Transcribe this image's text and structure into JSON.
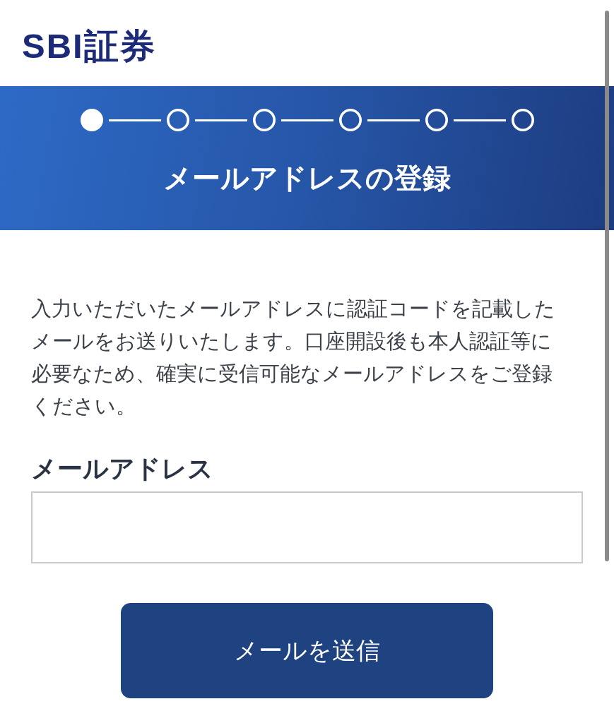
{
  "logo": {
    "text": "SBI証券"
  },
  "header": {
    "steps": [
      {
        "selected": true
      },
      {
        "selected": false
      },
      {
        "selected": false
      },
      {
        "selected": false
      },
      {
        "selected": false
      },
      {
        "selected": false
      }
    ],
    "title": "メールアドレスの登録"
  },
  "intro": "入力いただいたメールアドレスに認証コードを記載したメールをお送りいたします。口座開設後も本人認証等に必要なため、確実に受信可能なメールアドレスをご登録ください。",
  "email_field": {
    "label": "メールアドレス"
  },
  "submit_button": "メールを送信"
}
